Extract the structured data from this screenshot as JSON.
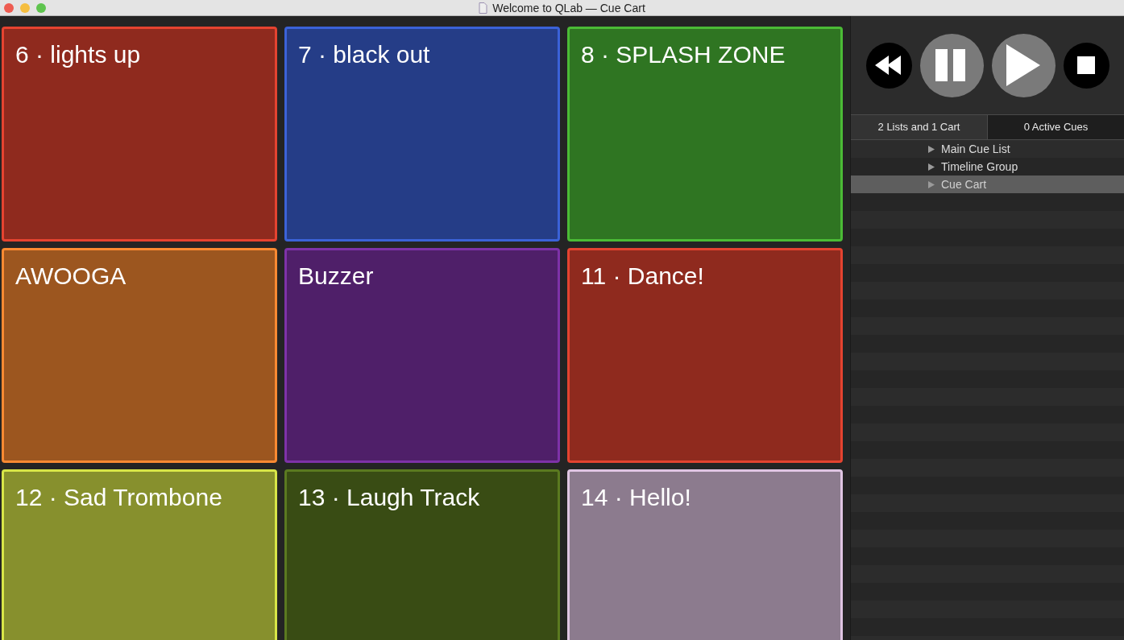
{
  "window": {
    "title": "Welcome to QLab — Cue Cart"
  },
  "cart": [
    {
      "label": "6 · lights up",
      "color": "#8f2a1e"
    },
    {
      "label": "7 · black out",
      "color": "#253d87"
    },
    {
      "label": "8 · SPLASH ZONE",
      "color": "#2f7522"
    },
    {
      "label": "AWOOGA",
      "color": "#9c561f"
    },
    {
      "label": "Buzzer",
      "color": "#4f1f69"
    },
    {
      "label": "11 · Dance!",
      "color": "#8f2a1e"
    },
    {
      "label": "12 · Sad Trombone",
      "color": "#87902d"
    },
    {
      "label": "13 · Laugh Track",
      "color": "#394c14"
    },
    {
      "label": "14 · Hello!",
      "color": "#8c7b8e"
    }
  ],
  "transport": [
    {
      "kind": "rewind"
    },
    {
      "kind": "pause"
    },
    {
      "kind": "go"
    },
    {
      "kind": "stop"
    }
  ],
  "tabs": [
    {
      "label": "2 Lists and 1 Cart",
      "selected": true
    },
    {
      "label": "0 Active Cues",
      "selected": false
    }
  ],
  "lists": [
    {
      "label": "Main Cue List",
      "selected": false
    },
    {
      "label": "Timeline Group",
      "selected": false
    },
    {
      "label": "Cue Cart",
      "selected": true
    }
  ]
}
